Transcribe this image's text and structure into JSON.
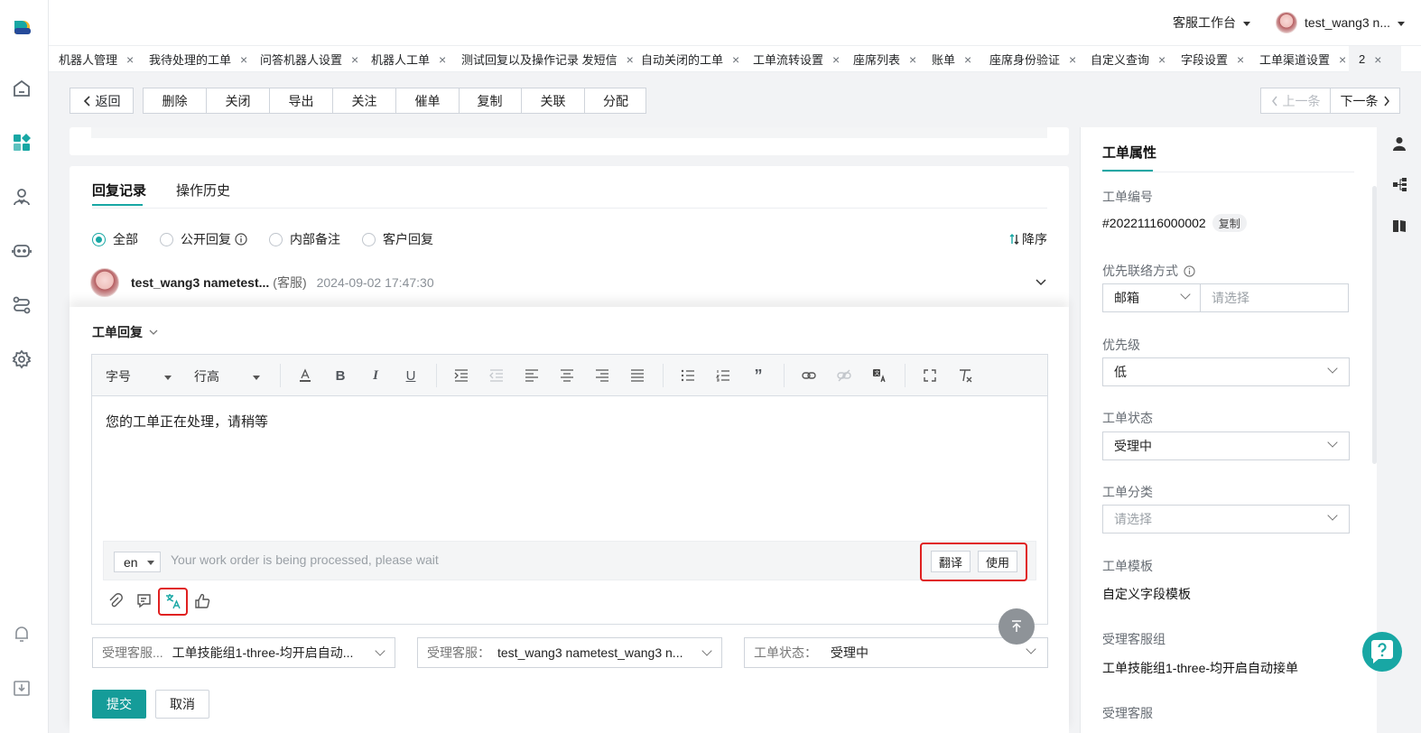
{
  "topbar": {
    "workspace_label": "客服工作台",
    "user_name": "test_wang3 n..."
  },
  "tabs": [
    {
      "label": "机器人管理"
    },
    {
      "label": "我待处理的工单"
    },
    {
      "label": "问答机器人设置"
    },
    {
      "label": "机器人工单"
    },
    {
      "label": "测试回复以及操作记录 发短信"
    },
    {
      "label": "自动关闭的工单"
    },
    {
      "label": "工单流转设置"
    },
    {
      "label": "座席列表"
    },
    {
      "label": "账单"
    },
    {
      "label": "座席身份验证"
    },
    {
      "label": "自定义查询"
    },
    {
      "label": "字段设置"
    },
    {
      "label": "工单渠道设置"
    },
    {
      "label": "2"
    }
  ],
  "toolbar": {
    "back": "返回",
    "actions": [
      "删除",
      "关闭",
      "导出",
      "关注",
      "催单",
      "复制",
      "关联",
      "分配"
    ],
    "prev": "上一条",
    "next": "下一条"
  },
  "records": {
    "tabs": [
      "回复记录",
      "操作历史"
    ],
    "filters": [
      "全部",
      "公开回复",
      "内部备注",
      "客户回复"
    ],
    "sort_label": "降序",
    "message": {
      "author": "test_wang3 nametest...",
      "role": "(客服)",
      "time": "2024-09-02 17:47:30"
    }
  },
  "reply": {
    "title": "工单回复",
    "font_size_label": "字号",
    "line_height_label": "行高",
    "content": "您的工单正在处理，请稍等",
    "language": "en",
    "translation_text": "Your work order is being processed, please wait",
    "translate_button": "翻译",
    "use_button": "使用",
    "selects": [
      {
        "label": "受理客服...",
        "value": "工单技能组1-three-均开启自动..."
      },
      {
        "label": "受理客服：",
        "value": "test_wang3 nametest_wang3 n..."
      },
      {
        "label": "工单状态：",
        "value": "受理中"
      }
    ],
    "submit": "提交",
    "cancel": "取消"
  },
  "properties": {
    "title": "工单属性",
    "ticket_number_label": "工单编号",
    "ticket_number": "#20221116000002",
    "copy_label": "复制",
    "contact_label": "优先联络方式",
    "contact_method": "邮箱",
    "contact_placeholder": "请选择",
    "priority_label": "优先级",
    "priority": "低",
    "status_label": "工单状态",
    "status": "受理中",
    "category_label": "工单分类",
    "category_placeholder": "请选择",
    "template_label": "工单模板",
    "template": "自定义字段模板",
    "group_label": "受理客服组",
    "group": "工单技能组1-three-均开启自动接单",
    "agent_label": "受理客服"
  },
  "colors": {
    "brand": "#18a7a4",
    "highlight": "#e02020"
  }
}
